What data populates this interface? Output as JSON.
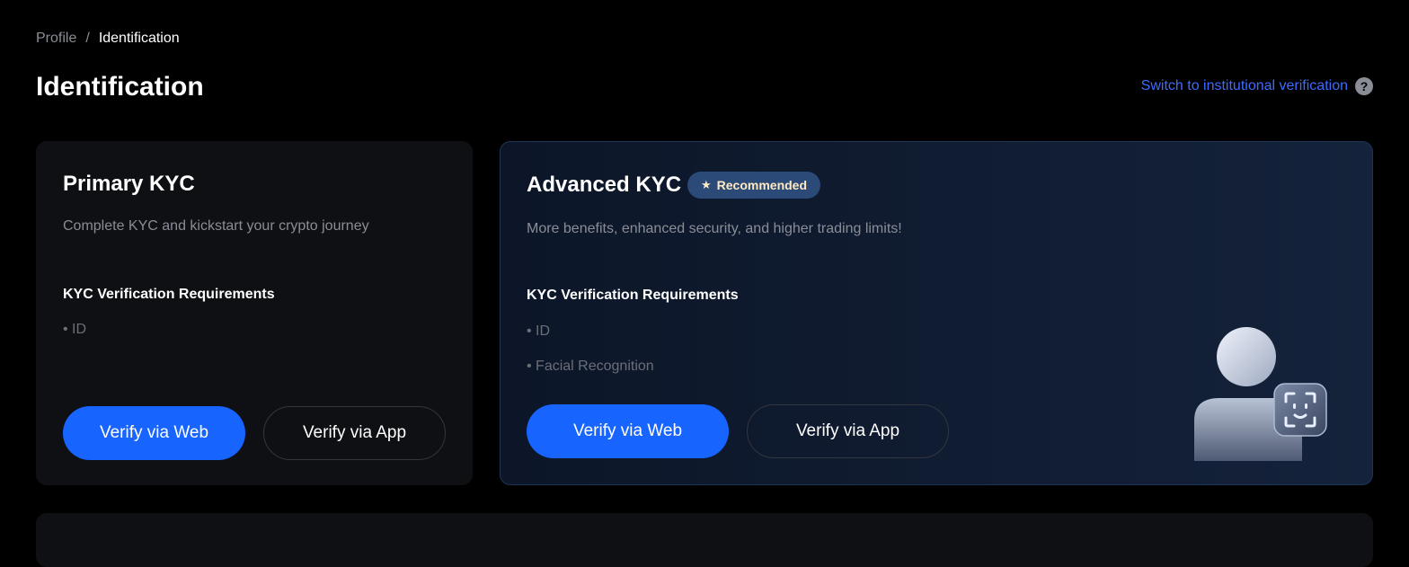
{
  "breadcrumb": {
    "parent": "Profile",
    "separator": "/",
    "current": "Identification"
  },
  "page": {
    "title": "Identification",
    "institutional_link": "Switch to institutional verification",
    "help_icon": "question-circle-icon"
  },
  "primary_kyc": {
    "title": "Primary KYC",
    "description": "Complete KYC and kickstart your crypto journey",
    "requirements_heading": "KYC Verification Requirements",
    "requirements": [
      "• ID"
    ],
    "verify_web": "Verify via Web",
    "verify_app": "Verify via App"
  },
  "advanced_kyc": {
    "title": "Advanced KYC",
    "badge": "Recommended",
    "badge_icon": "star-icon",
    "description": "More benefits, enhanced security, and higher trading limits!",
    "requirements_heading": "KYC Verification Requirements",
    "requirements": [
      "• ID",
      "• Facial Recognition"
    ],
    "verify_web": "Verify via Web",
    "verify_app": "Verify via App",
    "illustration_icon": "face-recognition-person-icon"
  },
  "colors": {
    "accent_blue": "#1764ff",
    "link_blue": "#3d6bff",
    "badge_text": "#ffe9c0"
  }
}
